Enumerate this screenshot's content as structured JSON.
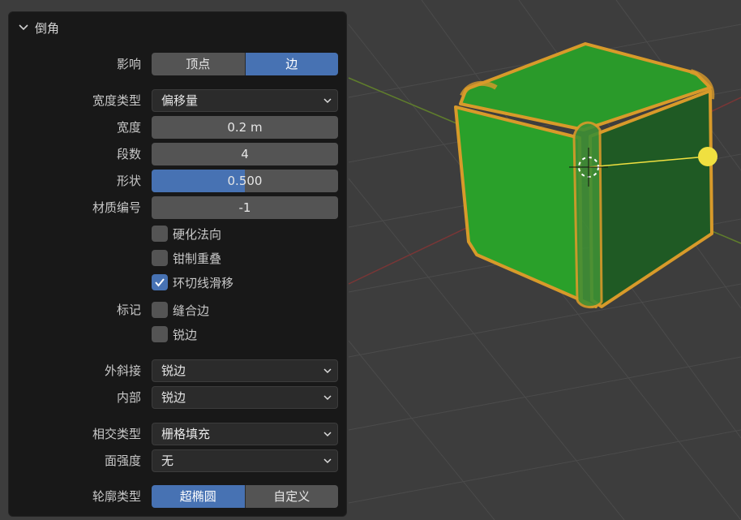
{
  "panel": {
    "title": "倒角",
    "affect": {
      "label": "影响",
      "options": [
        "顶点",
        "边"
      ],
      "selected": 1
    },
    "width_type": {
      "label": "宽度类型",
      "value": "偏移量"
    },
    "width": {
      "label": "宽度",
      "value": "0.2 m"
    },
    "segments": {
      "label": "段数",
      "value": "4"
    },
    "shape": {
      "label": "形状",
      "value": "0.500",
      "fraction": 0.5
    },
    "material": {
      "label": "材质编号",
      "value": "-1"
    },
    "harden_normals": {
      "label": "硬化法向",
      "checked": false
    },
    "clamp_overlap": {
      "label": "钳制重叠",
      "checked": false
    },
    "loop_slide": {
      "label": "环切线滑移",
      "checked": true
    },
    "mark": {
      "label": "标记",
      "seam": "缝合边",
      "seam_checked": false,
      "sharp": "锐边",
      "sharp_checked": false
    },
    "miter_outer": {
      "label": "外斜接",
      "value": "锐边"
    },
    "miter_inner": {
      "label": "内部",
      "value": "锐边"
    },
    "intersection": {
      "label": "相交类型",
      "value": "栅格填充"
    },
    "face_strength": {
      "label": "面强度",
      "value": "无"
    },
    "profile_type": {
      "label": "轮廓类型",
      "options": [
        "超椭圆",
        "自定义"
      ],
      "selected": 0
    }
  },
  "viewport": {
    "background": "#3d3d3d",
    "grid_color": "#4a4a4a",
    "x_axis_color": "#8a3a3a",
    "y_axis_color": "#6a8a30",
    "cube_face_colors": [
      "#2a9a2a",
      "#23832a",
      "#1f5f25"
    ],
    "cube_edge_color": "#d89a2a",
    "gizmo_color": "#f0e040"
  }
}
